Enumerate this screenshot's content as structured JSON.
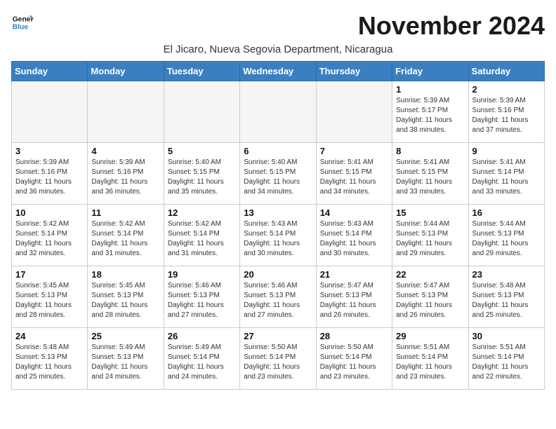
{
  "logo": {
    "line1": "General",
    "line2": "Blue"
  },
  "title": "November 2024",
  "subtitle": "El Jicaro, Nueva Segovia Department, Nicaragua",
  "weekdays": [
    "Sunday",
    "Monday",
    "Tuesday",
    "Wednesday",
    "Thursday",
    "Friday",
    "Saturday"
  ],
  "weeks": [
    [
      {
        "day": "",
        "info": ""
      },
      {
        "day": "",
        "info": ""
      },
      {
        "day": "",
        "info": ""
      },
      {
        "day": "",
        "info": ""
      },
      {
        "day": "",
        "info": ""
      },
      {
        "day": "1",
        "info": "Sunrise: 5:39 AM\nSunset: 5:17 PM\nDaylight: 11 hours\nand 38 minutes."
      },
      {
        "day": "2",
        "info": "Sunrise: 5:39 AM\nSunset: 5:16 PM\nDaylight: 11 hours\nand 37 minutes."
      }
    ],
    [
      {
        "day": "3",
        "info": "Sunrise: 5:39 AM\nSunset: 5:16 PM\nDaylight: 11 hours\nand 36 minutes."
      },
      {
        "day": "4",
        "info": "Sunrise: 5:39 AM\nSunset: 5:16 PM\nDaylight: 11 hours\nand 36 minutes."
      },
      {
        "day": "5",
        "info": "Sunrise: 5:40 AM\nSunset: 5:15 PM\nDaylight: 11 hours\nand 35 minutes."
      },
      {
        "day": "6",
        "info": "Sunrise: 5:40 AM\nSunset: 5:15 PM\nDaylight: 11 hours\nand 34 minutes."
      },
      {
        "day": "7",
        "info": "Sunrise: 5:41 AM\nSunset: 5:15 PM\nDaylight: 11 hours\nand 34 minutes."
      },
      {
        "day": "8",
        "info": "Sunrise: 5:41 AM\nSunset: 5:15 PM\nDaylight: 11 hours\nand 33 minutes."
      },
      {
        "day": "9",
        "info": "Sunrise: 5:41 AM\nSunset: 5:14 PM\nDaylight: 11 hours\nand 33 minutes."
      }
    ],
    [
      {
        "day": "10",
        "info": "Sunrise: 5:42 AM\nSunset: 5:14 PM\nDaylight: 11 hours\nand 32 minutes."
      },
      {
        "day": "11",
        "info": "Sunrise: 5:42 AM\nSunset: 5:14 PM\nDaylight: 11 hours\nand 31 minutes."
      },
      {
        "day": "12",
        "info": "Sunrise: 5:42 AM\nSunset: 5:14 PM\nDaylight: 11 hours\nand 31 minutes."
      },
      {
        "day": "13",
        "info": "Sunrise: 5:43 AM\nSunset: 5:14 PM\nDaylight: 11 hours\nand 30 minutes."
      },
      {
        "day": "14",
        "info": "Sunrise: 5:43 AM\nSunset: 5:14 PM\nDaylight: 11 hours\nand 30 minutes."
      },
      {
        "day": "15",
        "info": "Sunrise: 5:44 AM\nSunset: 5:13 PM\nDaylight: 11 hours\nand 29 minutes."
      },
      {
        "day": "16",
        "info": "Sunrise: 5:44 AM\nSunset: 5:13 PM\nDaylight: 11 hours\nand 29 minutes."
      }
    ],
    [
      {
        "day": "17",
        "info": "Sunrise: 5:45 AM\nSunset: 5:13 PM\nDaylight: 11 hours\nand 28 minutes."
      },
      {
        "day": "18",
        "info": "Sunrise: 5:45 AM\nSunset: 5:13 PM\nDaylight: 11 hours\nand 28 minutes."
      },
      {
        "day": "19",
        "info": "Sunrise: 5:46 AM\nSunset: 5:13 PM\nDaylight: 11 hours\nand 27 minutes."
      },
      {
        "day": "20",
        "info": "Sunrise: 5:46 AM\nSunset: 5:13 PM\nDaylight: 11 hours\nand 27 minutes."
      },
      {
        "day": "21",
        "info": "Sunrise: 5:47 AM\nSunset: 5:13 PM\nDaylight: 11 hours\nand 26 minutes."
      },
      {
        "day": "22",
        "info": "Sunrise: 5:47 AM\nSunset: 5:13 PM\nDaylight: 11 hours\nand 26 minutes."
      },
      {
        "day": "23",
        "info": "Sunrise: 5:48 AM\nSunset: 5:13 PM\nDaylight: 11 hours\nand 25 minutes."
      }
    ],
    [
      {
        "day": "24",
        "info": "Sunrise: 5:48 AM\nSunset: 5:13 PM\nDaylight: 11 hours\nand 25 minutes."
      },
      {
        "day": "25",
        "info": "Sunrise: 5:49 AM\nSunset: 5:13 PM\nDaylight: 11 hours\nand 24 minutes."
      },
      {
        "day": "26",
        "info": "Sunrise: 5:49 AM\nSunset: 5:14 PM\nDaylight: 11 hours\nand 24 minutes."
      },
      {
        "day": "27",
        "info": "Sunrise: 5:50 AM\nSunset: 5:14 PM\nDaylight: 11 hours\nand 23 minutes."
      },
      {
        "day": "28",
        "info": "Sunrise: 5:50 AM\nSunset: 5:14 PM\nDaylight: 11 hours\nand 23 minutes."
      },
      {
        "day": "29",
        "info": "Sunrise: 5:51 AM\nSunset: 5:14 PM\nDaylight: 11 hours\nand 23 minutes."
      },
      {
        "day": "30",
        "info": "Sunrise: 5:51 AM\nSunset: 5:14 PM\nDaylight: 11 hours\nand 22 minutes."
      }
    ]
  ]
}
